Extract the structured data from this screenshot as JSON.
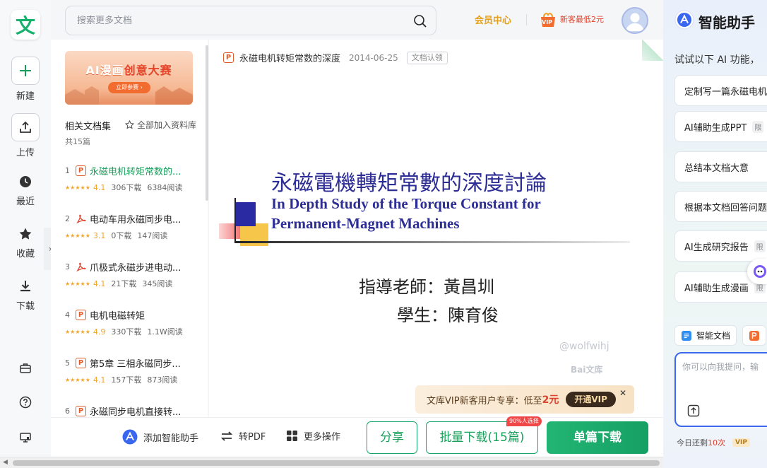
{
  "app": {
    "logo_char": "文"
  },
  "rail": {
    "items": [
      {
        "label": "新建"
      },
      {
        "label": "上传"
      },
      {
        "label": "最近"
      },
      {
        "label": "收藏"
      },
      {
        "label": "下载"
      }
    ]
  },
  "header": {
    "search_placeholder": "搜索更多文档",
    "vip_center": "会员中心",
    "vip_badge": "VIP",
    "newcomer": "新客最低2元"
  },
  "sidebar": {
    "banner_title_a": "AI漫画",
    "banner_title_b": "创意大赛",
    "banner_button": "立即参赛 ›",
    "set_title": "相关文档集",
    "add_all": "全部加入资料库",
    "count": "共15篇",
    "docs": [
      {
        "num": "1",
        "icon": "ppt",
        "title": "永磁电机转矩常数的...",
        "rating": "4.1",
        "downloads": "306下载",
        "reads": "6384阅读"
      },
      {
        "num": "2",
        "icon": "pdf",
        "title": "电动车用永磁同步电...",
        "rating": "3.1",
        "downloads": "0下载",
        "reads": "147阅读"
      },
      {
        "num": "3",
        "icon": "pdf",
        "title": "爪极式永磁步进电动...",
        "rating": "4.1",
        "downloads": "21下载",
        "reads": "345阅读"
      },
      {
        "num": "4",
        "icon": "ppt",
        "title": "电机电磁转矩",
        "rating": "4.9",
        "downloads": "330下载",
        "reads": "1.1W阅读"
      },
      {
        "num": "5",
        "icon": "ppt",
        "title": "第5章 三相永磁同步...",
        "rating": "4.1",
        "downloads": "157下载",
        "reads": "873阅读"
      },
      {
        "num": "6",
        "icon": "ppt",
        "title": "永磁同步电机直接转...",
        "rating": "",
        "downloads": "",
        "reads": ""
      }
    ]
  },
  "document": {
    "title": "永磁电机转矩常数的深度",
    "date": "2014-06-25",
    "claim": "文档认领",
    "slide": {
      "cn_title": "永磁電機轉矩常數的深度討論",
      "en_title_1": "In Depth Study of the Torque Constant for",
      "en_title_2": "Permanent-Magnet Machines",
      "advisor": "指導老師：黃昌圳",
      "student": "學生：陳育俊",
      "watermark": "@wolfwihj",
      "brand": "Bai文库"
    }
  },
  "promo": {
    "text": "文库VIP新客用户专享：低至",
    "price": "2元",
    "button": "开通VIP"
  },
  "bottom": {
    "add_assistant": "添加智能助手",
    "to_pdf": "转PDF",
    "more": "更多操作",
    "share": "分享",
    "batch": "批量下载(15篇)",
    "batch_tag": "90%人选择",
    "single": "单篇下载"
  },
  "ai": {
    "title": "智能助手",
    "hint": "试试以下 AI 功能，",
    "chips": [
      {
        "label": "定制写一篇永磁电机",
        "tag": ""
      },
      {
        "label": "AI辅助生成PPT",
        "tag": "限"
      },
      {
        "label": "总结本文档大意",
        "tag": ""
      },
      {
        "label": "根据本文档回答问题",
        "tag": ""
      },
      {
        "label": "AI生成研究报告",
        "tag": "限"
      },
      {
        "label": "AI辅助生成漫画",
        "tag": "限"
      }
    ],
    "tool_doc": "智能文档",
    "input_placeholder": "你可以向我提问，输",
    "remaining_prefix": "今日还剩",
    "remaining_count": "10次",
    "vip": "VIP"
  },
  "colors": {
    "brand_green": "#18a05b",
    "vip_gold": "#e6a11a",
    "accent_blue": "#3a67f0",
    "price_red": "#e0412c"
  }
}
